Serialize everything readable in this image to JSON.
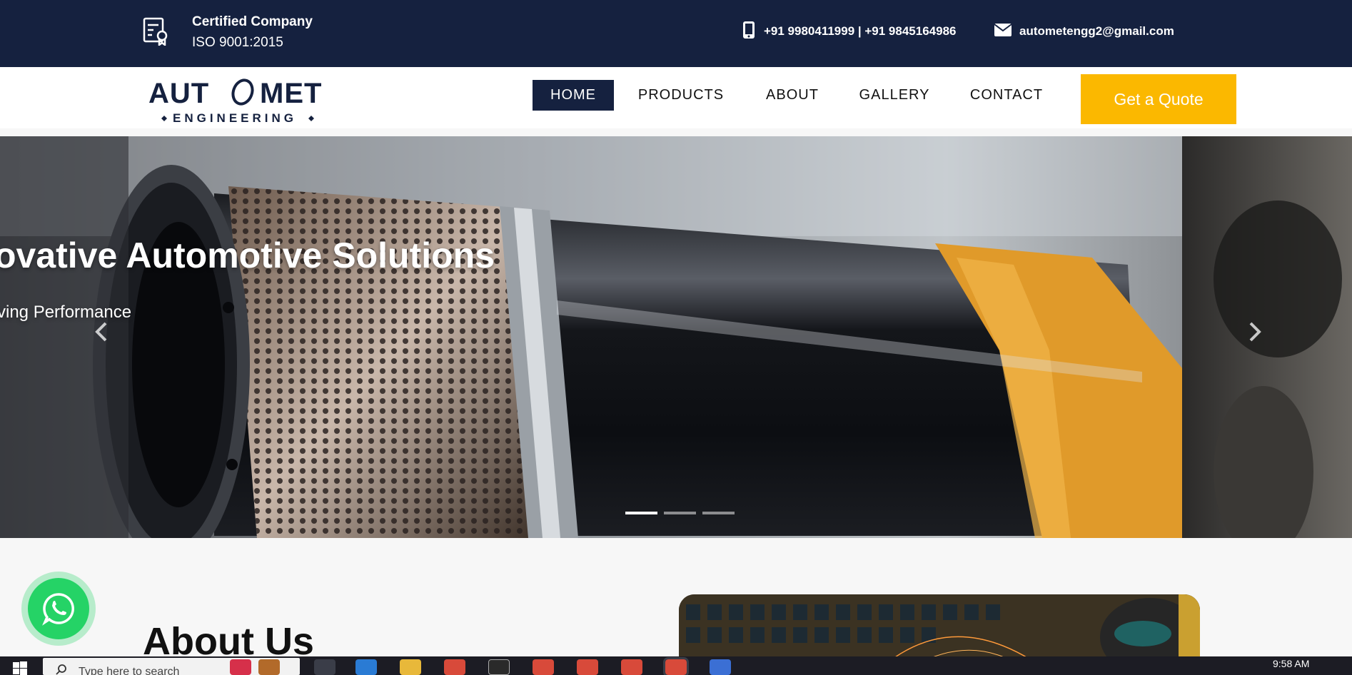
{
  "topbar": {
    "cert_title": "Certified Company",
    "cert_sub": "ISO 9001:2015",
    "phone": "+91 9980411999 | +91 9845164986",
    "email": "autometengg2@gmail.com"
  },
  "logo": {
    "line1": "AUT  MET",
    "line2": "ENGINEERING"
  },
  "nav": {
    "items": [
      "HOME",
      "PRODUCTS",
      "ABOUT",
      "GALLERY",
      "CONTACT"
    ],
    "active": "HOME",
    "quote": "Get a Quote"
  },
  "hero": {
    "title": "ovative Automotive Solutions",
    "subtitle": "ving Performance",
    "slides_total": 3,
    "slide_active": 1
  },
  "about": {
    "title": "About Us"
  },
  "taskbar": {
    "search_placeholder": "Type here to search",
    "clock": "9:58 AM"
  },
  "colors": {
    "navy": "#15213f",
    "accent": "#fbb800",
    "whatsapp": "#25d366"
  },
  "icons": [
    "certificate-icon",
    "phone-icon",
    "mail-icon",
    "chevron-left-icon",
    "chevron-right-icon",
    "whatsapp-icon",
    "windows-start-icon",
    "search-icon"
  ]
}
